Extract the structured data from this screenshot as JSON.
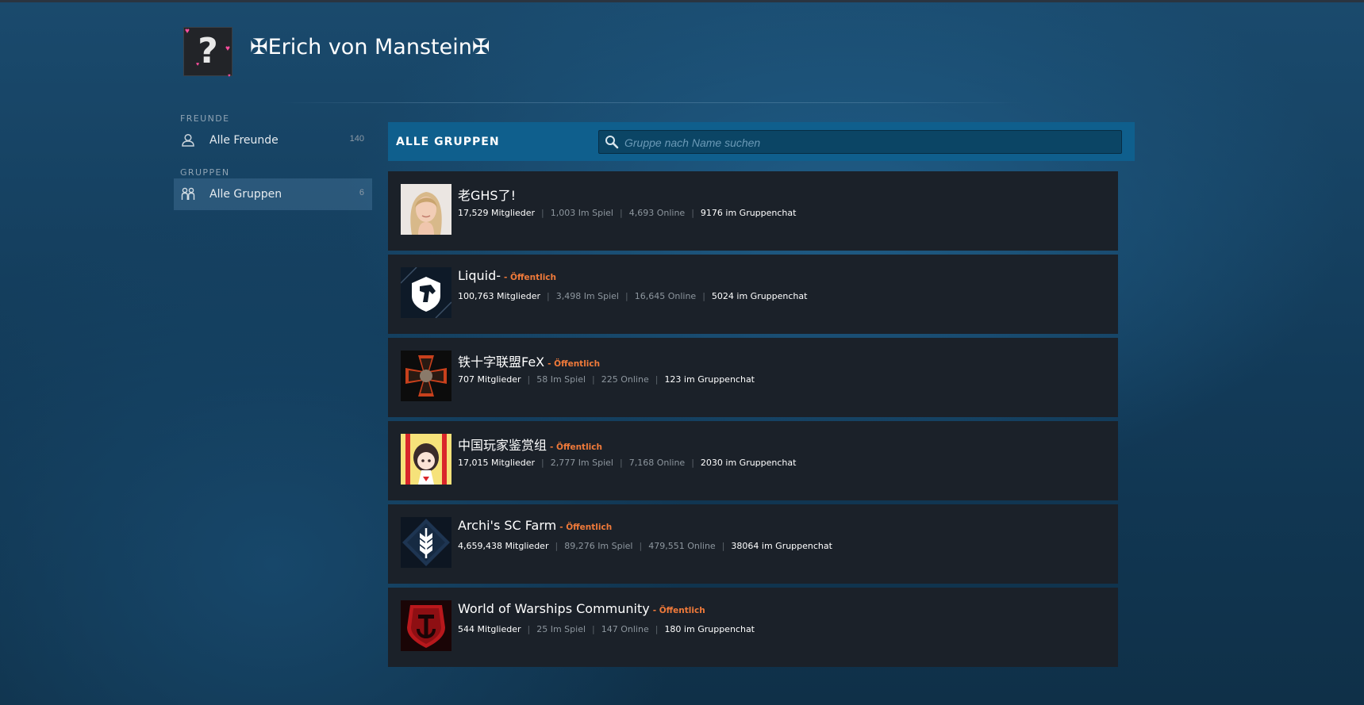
{
  "profile": {
    "name": "✠Erich von Manstein✠",
    "avatar_icon": "question-mark-avatar"
  },
  "sidebar": {
    "friends_heading": "FREUNDE",
    "friends_item": {
      "label": "Alle Freunde",
      "count": "140",
      "icon": "person-icon"
    },
    "groups_heading": "GRUPPEN",
    "groups_item": {
      "label": "Alle Gruppen",
      "count": "6",
      "icon": "group-icon"
    }
  },
  "groups": {
    "title": "ALLE GRUPPEN",
    "search_placeholder": "Gruppe nach Name suchen",
    "items": [
      {
        "name": "老GHS了!",
        "public_label": "",
        "members": "17,529 Mitglieder",
        "in_game": "1,003 Im Spiel",
        "online": "4,693 Online",
        "chat": "9176 im Gruppenchat",
        "avatar": "woman-photo"
      },
      {
        "name": "Liquid-",
        "public_label": "- Öffentlich",
        "members": "100,763 Mitglieder",
        "in_game": "3,498 Im Spiel",
        "online": "16,645 Online",
        "chat": "5024 im Gruppenchat",
        "avatar": "horse-logo"
      },
      {
        "name": "铁十字联盟FeX",
        "public_label": "- Öffentlich",
        "members": "707 Mitglieder",
        "in_game": "58 Im Spiel",
        "online": "225 Online",
        "chat": "123 im Gruppenchat",
        "avatar": "iron-cross-logo"
      },
      {
        "name": "中国玩家鉴赏组",
        "public_label": "- Öffentlich",
        "members": "17,015 Mitglieder",
        "in_game": "2,777 Im Spiel",
        "online": "7,168 Online",
        "chat": "2030 im Gruppenchat",
        "avatar": "anime-girl-logo"
      },
      {
        "name": "Archi's SC Farm",
        "public_label": "- Öffentlich",
        "members": "4,659,438 Mitglieder",
        "in_game": "89,276 Im Spiel",
        "online": "479,551 Online",
        "chat": "38064 im Gruppenchat",
        "avatar": "wheat-logo"
      },
      {
        "name": "World of Warships Community",
        "public_label": "- Öffentlich",
        "members": "544 Mitglieder",
        "in_game": "25 Im Spiel",
        "online": "147 Online",
        "chat": "180 im Gruppenchat",
        "avatar": "anchor-shield-logo"
      }
    ]
  },
  "colors": {
    "accent_header": "#0f5f8d",
    "public_label": "#f07a3a",
    "row_bg": "#1b2129"
  }
}
